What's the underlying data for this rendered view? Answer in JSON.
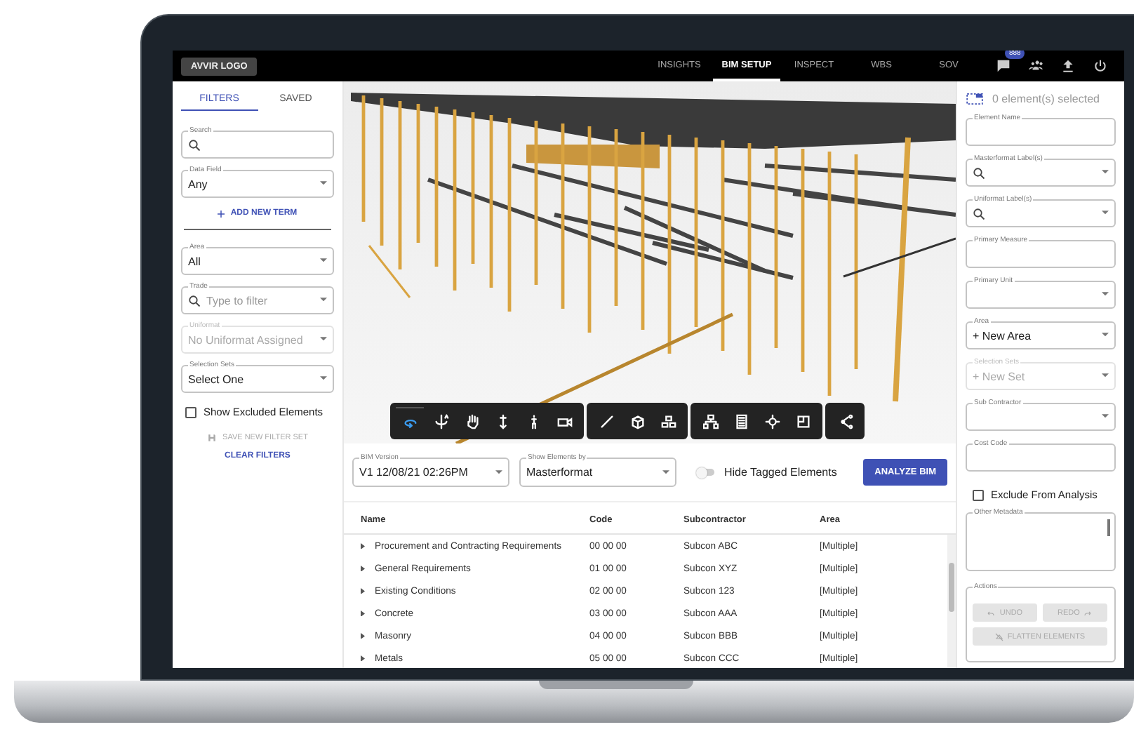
{
  "top_bar": {
    "logo": "AVVIR LOGO",
    "nav": [
      {
        "label": "INSIGHTS",
        "selected": false
      },
      {
        "label": "BIM SETUP",
        "selected": true
      },
      {
        "label": "INSPECT",
        "selected": false
      },
      {
        "label": "WBS",
        "selected": false
      },
      {
        "label": "SOV",
        "selected": false
      }
    ],
    "notification_badge": "888"
  },
  "left_panel": {
    "tabs": [
      {
        "label": "FILTERS",
        "selected": true
      },
      {
        "label": "SAVED",
        "selected": false
      }
    ],
    "fields_top": [
      {
        "kind": "search",
        "label": "Search",
        "disabled": false
      },
      {
        "kind": "select",
        "label": "Data Field",
        "value": "Any",
        "disabled": false
      }
    ],
    "add_term": "ADD NEW TERM",
    "fields": [
      {
        "kind": "select",
        "label": "Area",
        "value": "All",
        "disabled": false
      },
      {
        "kind": "search-select",
        "label": "Trade",
        "placeholder": "Type to filter",
        "disabled": false
      },
      {
        "kind": "select",
        "label": "Uniformat",
        "value": "No Uniformat Assigned",
        "disabled": true
      },
      {
        "kind": "select",
        "label": "Selection Sets",
        "value": "Select One",
        "disabled": false
      }
    ],
    "show_excluded": {
      "label": "Show Excluded Elements",
      "checked": false
    },
    "save_filter": {
      "label": "SAVE NEW FILTER SET",
      "disabled": true
    },
    "clear_filters": "CLEAR FILTERS"
  },
  "viewer": {
    "toolbar": [
      {
        "tools": [
          {
            "kind": "orbit",
            "selected": true
          },
          {
            "kind": "rotate",
            "selected": false
          },
          {
            "kind": "pan",
            "selected": false
          },
          {
            "kind": "vertical",
            "selected": false
          },
          {
            "kind": "walk",
            "selected": false
          },
          {
            "kind": "camera",
            "selected": false
          }
        ]
      },
      {
        "tools": [
          {
            "kind": "measure",
            "selected": false
          },
          {
            "kind": "section",
            "selected": false
          },
          {
            "kind": "explode",
            "selected": false
          }
        ]
      },
      {
        "tools": [
          {
            "kind": "tree",
            "selected": false
          },
          {
            "kind": "properties",
            "selected": false
          },
          {
            "kind": "settings",
            "selected": false
          },
          {
            "kind": "fullscreen",
            "selected": false
          }
        ]
      },
      {
        "tools": [
          {
            "kind": "share",
            "selected": false
          }
        ]
      }
    ]
  },
  "controls": {
    "bim_version": {
      "label": "BIM Version",
      "value": "V1 12/08/21 02:26PM"
    },
    "show_elements_by": {
      "label": "Show Elements by",
      "value": "Masterformat"
    },
    "hide_tagged": {
      "label": "Hide Tagged Elements",
      "on": false
    },
    "analyze_button": "ANALYZE BIM"
  },
  "table": {
    "columns": [
      "Name",
      "Code",
      "Subcontractor",
      "Area"
    ],
    "rows": [
      [
        "Procurement and Contracting Requirements",
        "00 00 00",
        "Subcon ABC",
        "[Multiple]"
      ],
      [
        "General Requirements",
        "01 00 00",
        "Subcon XYZ",
        "[Multiple]"
      ],
      [
        "Existing Conditions",
        "02 00 00",
        "Subcon 123",
        "[Multiple]"
      ],
      [
        "Concrete",
        "03 00 00",
        "Subcon AAA",
        "[Multiple]"
      ],
      [
        "Masonry",
        "04 00 00",
        "Subcon BBB",
        "[Multiple]"
      ],
      [
        "Metals",
        "05 00 00",
        "Subcon CCC",
        "[Multiple]"
      ]
    ]
  },
  "right_panel": {
    "selection": "0 element(s) selected",
    "fields": [
      {
        "kind": "text",
        "label": "Element Name",
        "disabled": false
      },
      {
        "kind": "search-select",
        "label": "Masterformat Label(s)",
        "disabled": false
      },
      {
        "kind": "search-select",
        "label": "Uniformat Label(s)",
        "disabled": false
      },
      {
        "kind": "text",
        "label": "Primary Measure",
        "disabled": false
      },
      {
        "kind": "select",
        "label": "Primary Unit",
        "disabled": false
      },
      {
        "kind": "select",
        "label": "Area",
        "value": "+ New Area",
        "disabled": false
      },
      {
        "kind": "select",
        "label": "Selection Sets",
        "value": "+ New Set",
        "disabled": true
      },
      {
        "kind": "select",
        "label": "Sub Contractor",
        "disabled": false
      },
      {
        "kind": "text",
        "label": "Cost Code",
        "disabled": false
      }
    ],
    "exclude": {
      "label": "Exclude From Analysis",
      "checked": false
    },
    "other_metadata": {
      "label": "Other Metadata"
    },
    "actions": {
      "label": "Actions",
      "buttons": [
        {
          "kind": "undo",
          "label": "UNDO",
          "disabled": true
        },
        {
          "kind": "redo",
          "label": "REDO",
          "disabled": true
        },
        {
          "kind": "flatten",
          "label": "FLATTEN ELEMENTS",
          "disabled": true
        }
      ]
    }
  }
}
